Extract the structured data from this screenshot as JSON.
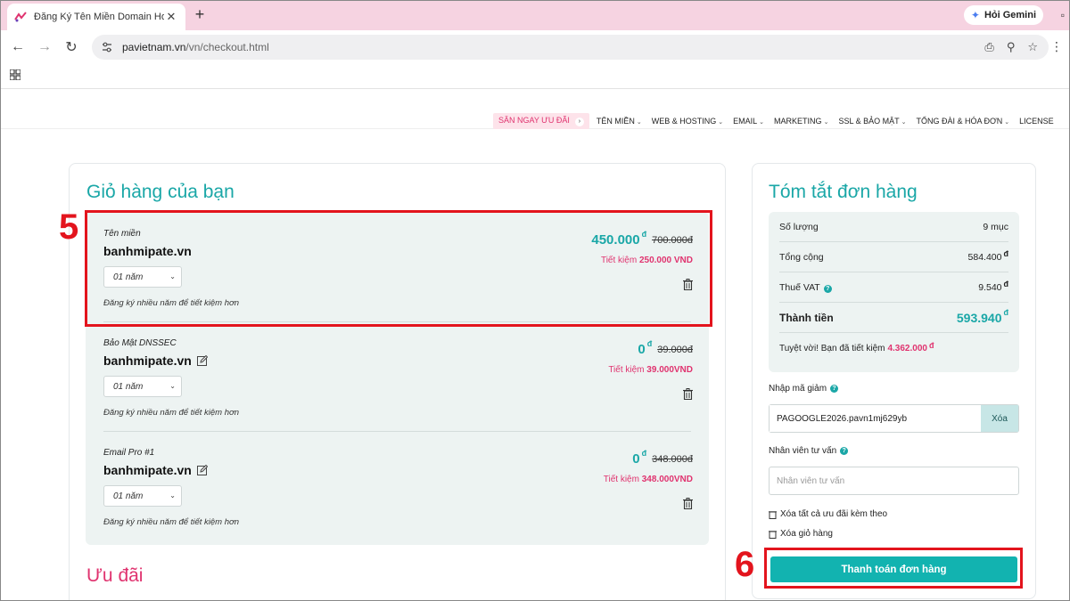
{
  "browser": {
    "tab_title": "Đăng Ký Tên Miền Domain Hos",
    "tab_close": "✕",
    "newtab": "+",
    "gemini_label": "Hỏi Gemini",
    "url_host": "pavietnam.vn",
    "url_path": "/vn/checkout.html",
    "icons": [
      "back-icon",
      "forward-icon",
      "reload-icon",
      "site-info-icon",
      "install-icon",
      "zoom-icon",
      "star-icon",
      "menu-icon",
      "apps-icon"
    ]
  },
  "sitenav": {
    "promo": "SĂN NGAY ƯU ĐÃI",
    "items": [
      "TÊN MIỀN",
      "WEB & HOSTING",
      "EMAIL",
      "MARKETING",
      "SSL & BẢO MẬT",
      "TỔNG ĐÀI & HÓA ĐƠN",
      "LICENSE"
    ]
  },
  "cart": {
    "title": "Giỏ hàng của bạn",
    "items": [
      {
        "type": "Tên miền",
        "domain": "banhmipate.vn",
        "term": "01 năm",
        "hint": "Đăng ký nhiều năm để tiết kiệm hơn",
        "price": "450.000",
        "currency": "đ",
        "old_price": "700.000đ",
        "save_label": "Tiết kiệm",
        "save_value": "250.000 VND"
      },
      {
        "type": "Bảo Mật DNSSEC",
        "domain": "banhmipate.vn",
        "term": "01 năm",
        "hint": "Đăng ký nhiều năm để tiết kiệm hơn",
        "price": "0",
        "currency": "đ",
        "old_price": "39.000đ",
        "save_label": "Tiết kiệm",
        "save_value": "39.000VND"
      },
      {
        "type": "Email Pro #1",
        "domain": "banhmipate.vn",
        "term": "01 năm",
        "hint": "Đăng ký nhiều năm để tiết kiệm hơn",
        "price": "0",
        "currency": "đ",
        "old_price": "348.000đ",
        "save_label": "Tiết kiệm",
        "save_value": "348.000VND"
      }
    ],
    "deals_title": "Ưu đãi"
  },
  "summary": {
    "title": "Tóm tắt đơn hàng",
    "rows": [
      {
        "label": "Số lượng",
        "value": "9 mục"
      },
      {
        "label": "Tổng cộng",
        "value": "584.400",
        "currency": "đ"
      },
      {
        "label": "Thuế VAT",
        "value": "9.540",
        "currency": "đ"
      },
      {
        "label": "Thành tiền",
        "value": "593.940",
        "currency": "đ"
      }
    ],
    "note_prefix": "Tuyệt vời! Bạn đã tiết kiệm",
    "note_value": "4.362.000",
    "note_currency": "đ",
    "coupon_label": "Nhập mã giảm",
    "coupon_value": "PAGOOGLE2026.pavn1mj629yb",
    "coupon_clear": "Xóa",
    "staff_label": "Nhân viên tư vấn",
    "staff_placeholder": "Nhân viên tư vấn",
    "clear_deals": "Xóa tất cả ưu đãi kèm theo",
    "clear_cart": "Xóa giỏ hàng",
    "pay_button": "Thanh toán đơn hàng"
  },
  "annotations": {
    "step5": "5",
    "step6": "6",
    "color": "#e3141d"
  },
  "colors": {
    "accent": "#1aa7a7",
    "pink": "#e0336f",
    "pay_button": "#12b3b0"
  }
}
